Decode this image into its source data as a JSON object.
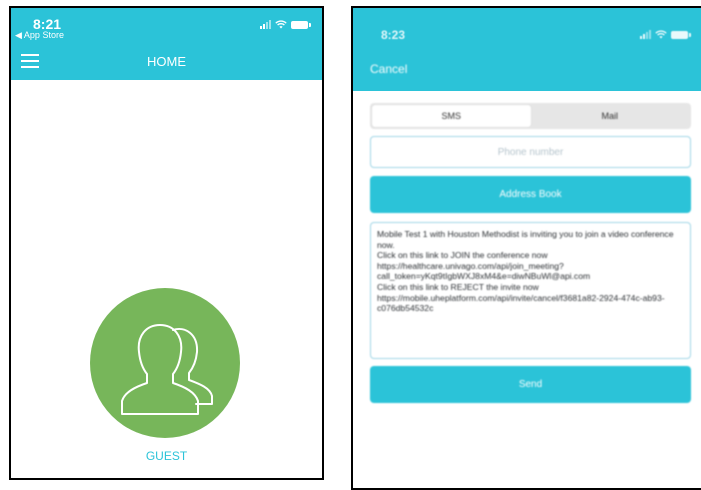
{
  "screen_home": {
    "status": {
      "time": "8:21",
      "back_label": "◀ App Store"
    },
    "nav": {
      "title": "HOME",
      "menu_icon": "hamburger-menu-icon"
    },
    "guest": {
      "icon": "users-icon",
      "label": "GUEST",
      "circle_color": "#77b65a"
    }
  },
  "screen_invite": {
    "status": {
      "time": "8:23"
    },
    "nav": {
      "cancel_label": "Cancel"
    },
    "segmented": {
      "options": [
        "SMS",
        "Mail"
      ],
      "selected": "SMS"
    },
    "phone_field": {
      "placeholder": "Phone number",
      "value": ""
    },
    "address_book_label": "Address Book",
    "message": "Mobile Test 1 with Houston Methodist is inviting you to join a video conference now.\nClick on this link to JOIN the conference now https://healthcare.univago.com/api/join_meeting?call_token=yKqt9tIgbWXJ8xM4&e=diwNBuWl@api.com\nClick on this link to REJECT the invite now https://mobile.uheplatform.com/api/invite/cancel/f3681a82-2924-474c-ab93-c076db54532c",
    "send_label": "Send"
  },
  "colors": {
    "accent": "#2bc3d8",
    "guest_green": "#77b65a",
    "field_border": "#9fd5e6"
  }
}
